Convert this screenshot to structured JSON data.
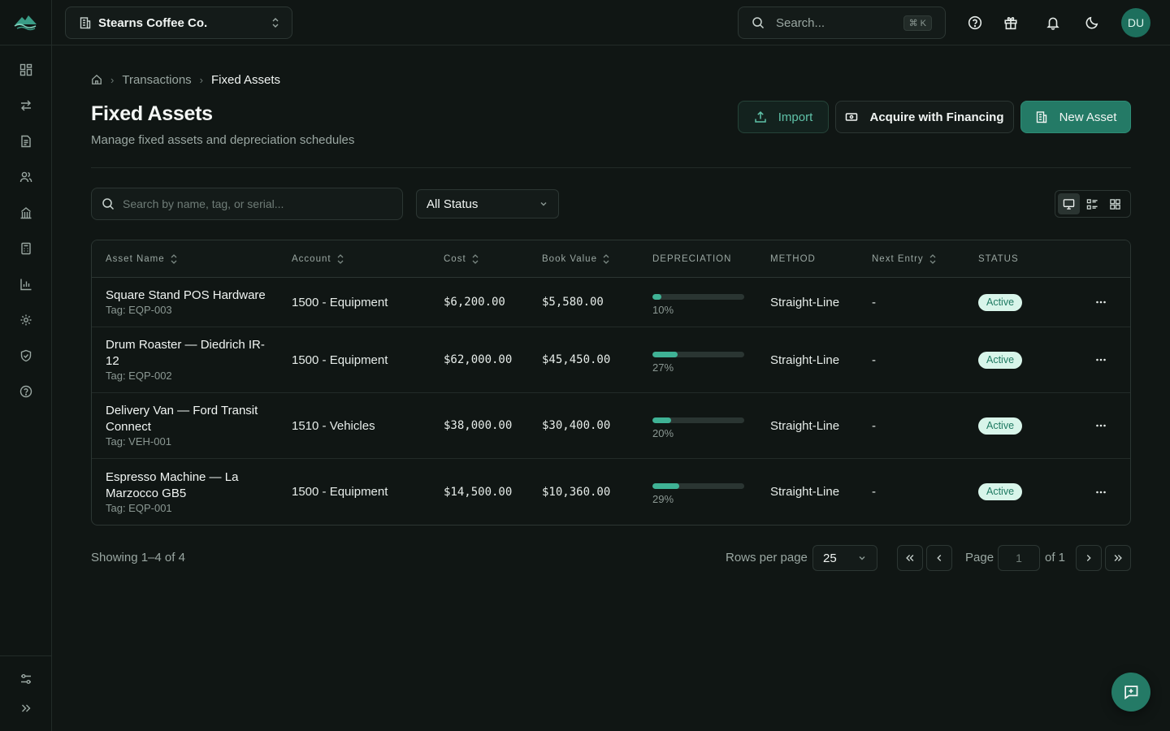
{
  "theme": {
    "accent": "#247a66",
    "accent_text": "#5fc2a8",
    "badge_bg": "#d8f5ea",
    "badge_text": "#1f7a62",
    "bar_fill": "#3fb295"
  },
  "sidebar": {
    "logo_icon": "mountain-wave-logo",
    "items": [
      {
        "icon": "dashboard-grid-icon"
      },
      {
        "icon": "arrows-exchange-icon"
      },
      {
        "icon": "document-icon"
      },
      {
        "icon": "users-icon"
      },
      {
        "icon": "building-icon"
      },
      {
        "icon": "calculator-icon"
      },
      {
        "icon": "bar-chart-icon"
      },
      {
        "icon": "settings-gear-icon"
      },
      {
        "icon": "shield-icon"
      },
      {
        "icon": "help-circle-icon"
      }
    ],
    "bottom": [
      {
        "icon": "sliders-icon"
      },
      {
        "icon": "chevrons-right-icon"
      }
    ]
  },
  "topbar": {
    "company": "Stearns Coffee Co.",
    "search_placeholder": "Search...",
    "search_shortcut": "⌘ K",
    "avatar_initials": "DU"
  },
  "breadcrumb": {
    "parent": "Transactions",
    "current": "Fixed Assets"
  },
  "page": {
    "title": "Fixed Assets",
    "subtitle": "Manage fixed assets and depreciation schedules"
  },
  "actions": {
    "import": "Import",
    "acquire": "Acquire with Financing",
    "new_asset": "New Asset"
  },
  "filters": {
    "search_placeholder": "Search by name, tag, or serial...",
    "status_value": "All Status"
  },
  "table": {
    "columns": {
      "asset_name": "Asset Name",
      "account": "Account",
      "cost": "Cost",
      "book_value": "Book Value",
      "depreciation": "DEPRECIATION",
      "method": "METHOD",
      "next_entry": "Next Entry",
      "status": "STATUS"
    },
    "rows": [
      {
        "name_line1": "Square Stand POS Hardware",
        "name_line2": "",
        "tag": "Tag: EQP-003",
        "account": "1500 - Equipment",
        "cost": "$6,200.00",
        "book_value": "$5,580.00",
        "depreciation_pct": 10,
        "depreciation_label": "10%",
        "method": "Straight-Line",
        "next_entry": "-",
        "status": "Active"
      },
      {
        "name_line1": "Drum Roaster — Diedrich IR-",
        "name_line2": "12",
        "tag": "Tag: EQP-002",
        "account": "1500 - Equipment",
        "cost": "$62,000.00",
        "book_value": "$45,450.00",
        "depreciation_pct": 27,
        "depreciation_label": "27%",
        "method": "Straight-Line",
        "next_entry": "-",
        "status": "Active"
      },
      {
        "name_line1": "Delivery Van — Ford Transit",
        "name_line2": "Connect",
        "tag": "Tag: VEH-001",
        "account": "1510 - Vehicles",
        "cost": "$38,000.00",
        "book_value": "$30,400.00",
        "depreciation_pct": 20,
        "depreciation_label": "20%",
        "method": "Straight-Line",
        "next_entry": "-",
        "status": "Active"
      },
      {
        "name_line1": "Espresso Machine — La",
        "name_line2": "Marzocco GB5",
        "tag": "Tag: EQP-001",
        "account": "1500 - Equipment",
        "cost": "$14,500.00",
        "book_value": "$10,360.00",
        "depreciation_pct": 29,
        "depreciation_label": "29%",
        "method": "Straight-Line",
        "next_entry": "-",
        "status": "Active"
      }
    ]
  },
  "pagination": {
    "showing": "Showing 1–4 of 4",
    "rows_per_page_label": "Rows per page",
    "rows_per_page": "25",
    "page_label": "Page",
    "page_value": "1",
    "of_label": "of 1"
  }
}
